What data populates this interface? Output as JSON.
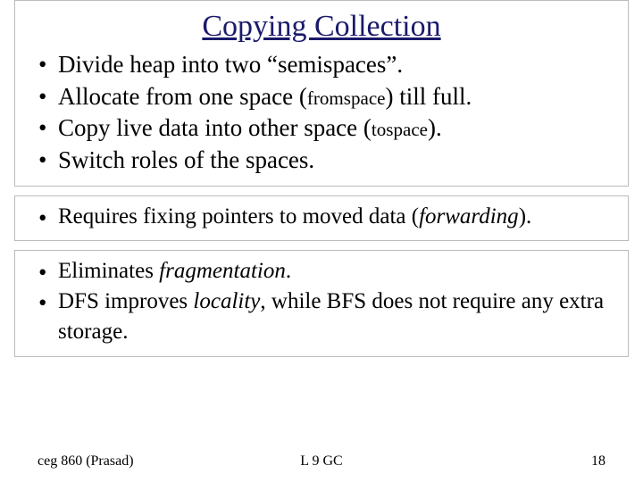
{
  "title": "Copying Collection",
  "group1": {
    "b1": "Divide heap into two “semispaces”.",
    "b2a": "Allocate from one space (",
    "b2b": "fromspace",
    "b2c": ") till full.",
    "b3a": "Copy live data into other space (",
    "b3b": "tospace",
    "b3c": ").",
    "b4": "Switch roles of the spaces."
  },
  "group2": {
    "b1a": "Requires fixing pointers to moved data  (",
    "b1b": "forwarding",
    "b1c": ")."
  },
  "group3": {
    "b1a": "Eliminates ",
    "b1b": "fragmentation",
    "b1c": ".",
    "b2a": "DFS improves ",
    "b2b": "locality",
    "b2c": ", while BFS does not require any extra storage."
  },
  "footer": {
    "left": "ceg 860 (Prasad)",
    "center": "L 9 GC",
    "right": "18"
  }
}
